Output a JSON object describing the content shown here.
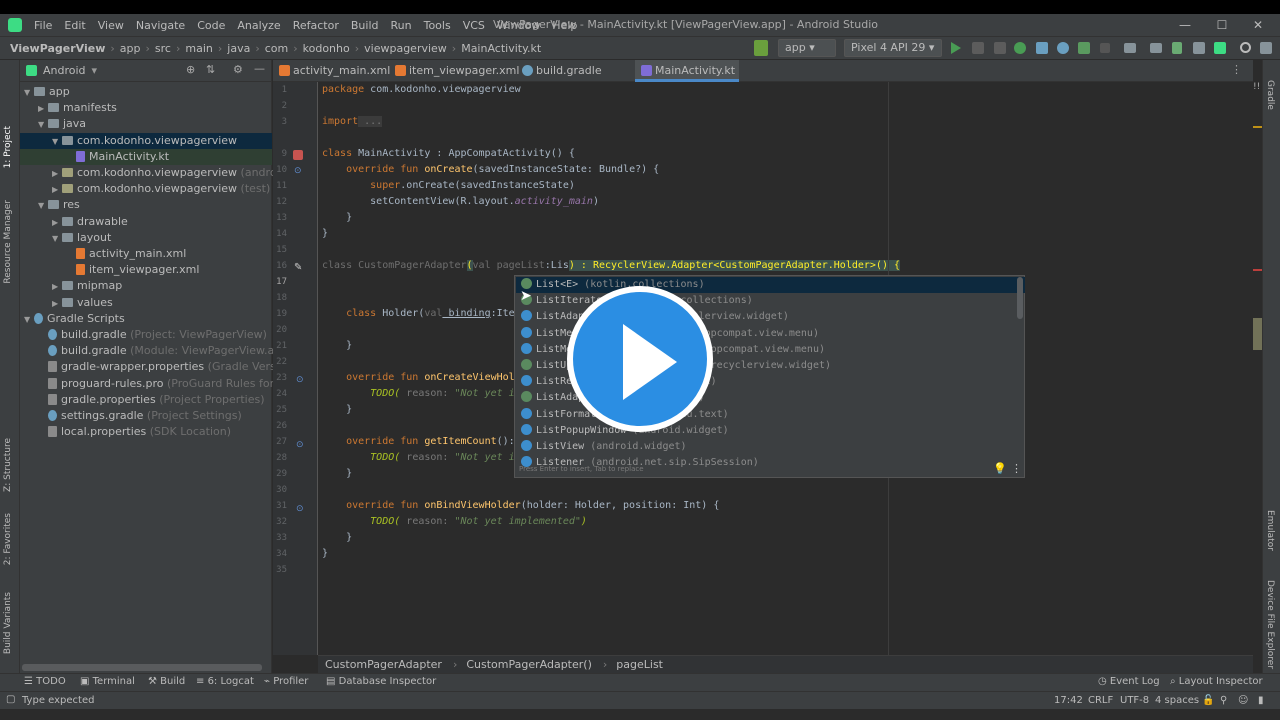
{
  "window": {
    "title": "ViewPagerView - MainActivity.kt [ViewPagerView.app] - Android Studio",
    "min": "—",
    "max": "☐",
    "close": "✕"
  },
  "menu": [
    "File",
    "Edit",
    "View",
    "Navigate",
    "Code",
    "Analyze",
    "Refactor",
    "Build",
    "Run",
    "Tools",
    "VCS",
    "Window",
    "Help"
  ],
  "breadcrumbs": [
    "ViewPagerView",
    "app",
    "src",
    "main",
    "java",
    "com",
    "kodonho",
    "viewpagerview",
    "MainActivity.kt"
  ],
  "toolbar": {
    "run_config": "app",
    "device": "Pixel 4 API 29"
  },
  "project_panel": {
    "view": "Android",
    "tree": [
      {
        "label": "app",
        "hint": "",
        "indent": 0,
        "arrow": "▼",
        "icon": "folder"
      },
      {
        "label": "manifests",
        "hint": "",
        "indent": 1,
        "arrow": "▶",
        "icon": "folder"
      },
      {
        "label": "java",
        "hint": "",
        "indent": 1,
        "arrow": "▼",
        "icon": "folder"
      },
      {
        "label": "com.kodonho.viewpagerview",
        "hint": "",
        "indent": 2,
        "arrow": "▼",
        "icon": "folder",
        "selected": true
      },
      {
        "label": "MainActivity.kt",
        "hint": "",
        "indent": 3,
        "arrow": "",
        "icon": "kt",
        "selected": true
      },
      {
        "label": "com.kodonho.viewpagerview",
        "hint": "(androidTest)",
        "indent": 2,
        "arrow": "▶",
        "icon": "folder",
        "green": true
      },
      {
        "label": "com.kodonho.viewpagerview",
        "hint": "(test)",
        "indent": 2,
        "arrow": "▶",
        "icon": "folder",
        "green": true
      },
      {
        "label": "res",
        "hint": "",
        "indent": 1,
        "arrow": "▼",
        "icon": "folder"
      },
      {
        "label": "drawable",
        "hint": "",
        "indent": 2,
        "arrow": "▶",
        "icon": "folder"
      },
      {
        "label": "layout",
        "hint": "",
        "indent": 2,
        "arrow": "▼",
        "icon": "folder"
      },
      {
        "label": "activity_main.xml",
        "hint": "",
        "indent": 3,
        "arrow": "",
        "icon": "xml"
      },
      {
        "label": "item_viewpager.xml",
        "hint": "",
        "indent": 3,
        "arrow": "",
        "icon": "xml"
      },
      {
        "label": "mipmap",
        "hint": "",
        "indent": 2,
        "arrow": "▶",
        "icon": "folder"
      },
      {
        "label": "values",
        "hint": "",
        "indent": 2,
        "arrow": "▶",
        "icon": "folder"
      },
      {
        "label": "Gradle Scripts",
        "hint": "",
        "indent": 0,
        "arrow": "▼",
        "icon": "gradle"
      },
      {
        "label": "build.gradle",
        "hint": "(Project: ViewPagerView)",
        "indent": 1,
        "arrow": "",
        "icon": "gradle"
      },
      {
        "label": "build.gradle",
        "hint": "(Module: ViewPagerView.app)",
        "indent": 1,
        "arrow": "",
        "icon": "gradle"
      },
      {
        "label": "gradle-wrapper.properties",
        "hint": "(Gradle Version)",
        "indent": 1,
        "arrow": "",
        "icon": "props"
      },
      {
        "label": "proguard-rules.pro",
        "hint": "(ProGuard Rules for ViewPag",
        "indent": 1,
        "arrow": "",
        "icon": "props"
      },
      {
        "label": "gradle.properties",
        "hint": "(Project Properties)",
        "indent": 1,
        "arrow": "",
        "icon": "props"
      },
      {
        "label": "settings.gradle",
        "hint": "(Project Settings)",
        "indent": 1,
        "arrow": "",
        "icon": "gradle"
      },
      {
        "label": "local.properties",
        "hint": "(SDK Location)",
        "indent": 1,
        "arrow": "",
        "icon": "props"
      }
    ]
  },
  "left_strip": [
    "1: Project",
    "Resource Manager",
    "Z: Structure",
    "2: Favorites",
    "Build Variants"
  ],
  "right_strip": [
    "Gradle",
    "Emulator",
    "Device File Explorer"
  ],
  "tabs": [
    {
      "label": "activity_main.xml",
      "icon": "xml"
    },
    {
      "label": "item_viewpager.xml",
      "icon": "xml"
    },
    {
      "label": "build.gradle (:app)",
      "icon": "gradle"
    },
    {
      "label": "MainActivity.kt",
      "icon": "kt",
      "active": true
    }
  ],
  "line_numbers": [
    "1",
    "2",
    "3",
    "9",
    "10",
    "11",
    "12",
    "13",
    "14",
    "15",
    "16",
    "17",
    "18",
    "19",
    "20",
    "21",
    "22",
    "23",
    "24",
    "25",
    "26",
    "27",
    "28",
    "29",
    "30",
    "31",
    "32",
    "33",
    "34",
    "35"
  ],
  "autocomplete": {
    "items": [
      {
        "name": "List<E>",
        "pkg": " (kotlin.collections)",
        "icon": "i"
      },
      {
        "name": "ListIterator<T>",
        "pkg": " (kotlin.collections)",
        "icon": "i"
      },
      {
        "name": "ListAdapter",
        "pkg": " (androidx.recyclerview.widget)",
        "icon": "c"
      },
      {
        "name": "ListMenuItemView",
        "pkg": " (androidx.appcompat.view.menu)",
        "icon": "c"
      },
      {
        "name": "ListMenuPresenter",
        "pkg": " (androidx.appcompat.view.menu)",
        "icon": "c"
      },
      {
        "name": "ListUpdateCallback",
        "pkg": " (androidx.recyclerview.widget)",
        "icon": "i"
      },
      {
        "name": "ListResourceBundle",
        "pkg": " (java.util)",
        "icon": "c"
      },
      {
        "name": "ListAdapter",
        "pkg": " (android.widget)",
        "icon": "i"
      },
      {
        "name": "ListFormatter",
        "pkg": " (android.icu.text)",
        "icon": "c"
      },
      {
        "name": "ListPopupWindow",
        "pkg": " (android.widget)",
        "icon": "c"
      },
      {
        "name": "ListView",
        "pkg": " (android.widget)",
        "icon": "c"
      },
      {
        "name": "Listener",
        "pkg": " (android.net.sip.SipSession)",
        "icon": "c"
      }
    ],
    "footer": "Press Enter to insert, Tab to replace",
    "menu": "⋮"
  },
  "code_breadcrumb": [
    "CustomPagerAdapter",
    "CustomPagerAdapter()",
    "pageList"
  ],
  "tool_windows": [
    "TODO",
    "Terminal",
    "Build",
    "6: Logcat",
    "Profiler",
    "Database Inspector"
  ],
  "tool_windows_right": [
    "Event Log",
    "Layout Inspector"
  ],
  "status": {
    "message": "Type expected",
    "position": "17:42",
    "line_sep": "CRLF",
    "encoding": "UTF-8",
    "indent": "4 spaces"
  },
  "code_text": {
    "l1a": "package",
    "l1b": " com.kodonho.viewpagerview",
    "l3a": "import",
    "l3b": " ...",
    "l9a": "class",
    "l9b": " MainActivity : AppCompatActivity() {",
    "l10a": "    override fun ",
    "l10b": "onCreate",
    "l10c": "(savedInstanceState: Bundle?) {",
    "l11a": "        super",
    "l11b": ".onCreate(savedInstanceState)",
    "l12a": "        setContentView(R.layout.",
    "l12b": "activity_main",
    "l12c": ")",
    "l13": "    }",
    "l14": "}",
    "l16a": "class",
    "l16b": " CustomPagerAdapter",
    "l16c": "(",
    "l16d": "val",
    "l16e": " pageList",
    "l16f": ":Lis",
    "l16g": ") : RecyclerView.Adapter<CustomPagerAdapter.Holder>() {",
    "l19a": "    class",
    "l19b": " Holder(",
    "l19c": "val",
    "l19d": " binding",
    "l19e": ":ItemV",
    "l21": "    }",
    "l23a": "    override fun ",
    "l23b": "onCreateViewHolde",
    "l24a": "        TODO(",
    "l24b": " reason: ",
    "l24c": "\"Not yet imple",
    "l25": "    }",
    "l27a": "    override fun ",
    "l27b": "getItemCount",
    "l27c": "(): I",
    "l28a": "        TODO(",
    "l28b": " reason: ",
    "l28c": "\"Not yet imple",
    "l29": "    }",
    "l31a": "    override fun ",
    "l31b": "onBindViewHolder",
    "l31c": "(holder: Holder, position: Int) {",
    "l32a": "        TODO(",
    "l32b": " reason: ",
    "l32c": "\"Not yet implemented\"",
    "l32d": ")",
    "l33": "    }",
    "l34": "}"
  },
  "colors": {
    "accent": "#4a88c7",
    "keyword": "#cc7832",
    "function": "#ffc66d",
    "string": "#6a8759",
    "play": "#2b8ee3"
  }
}
